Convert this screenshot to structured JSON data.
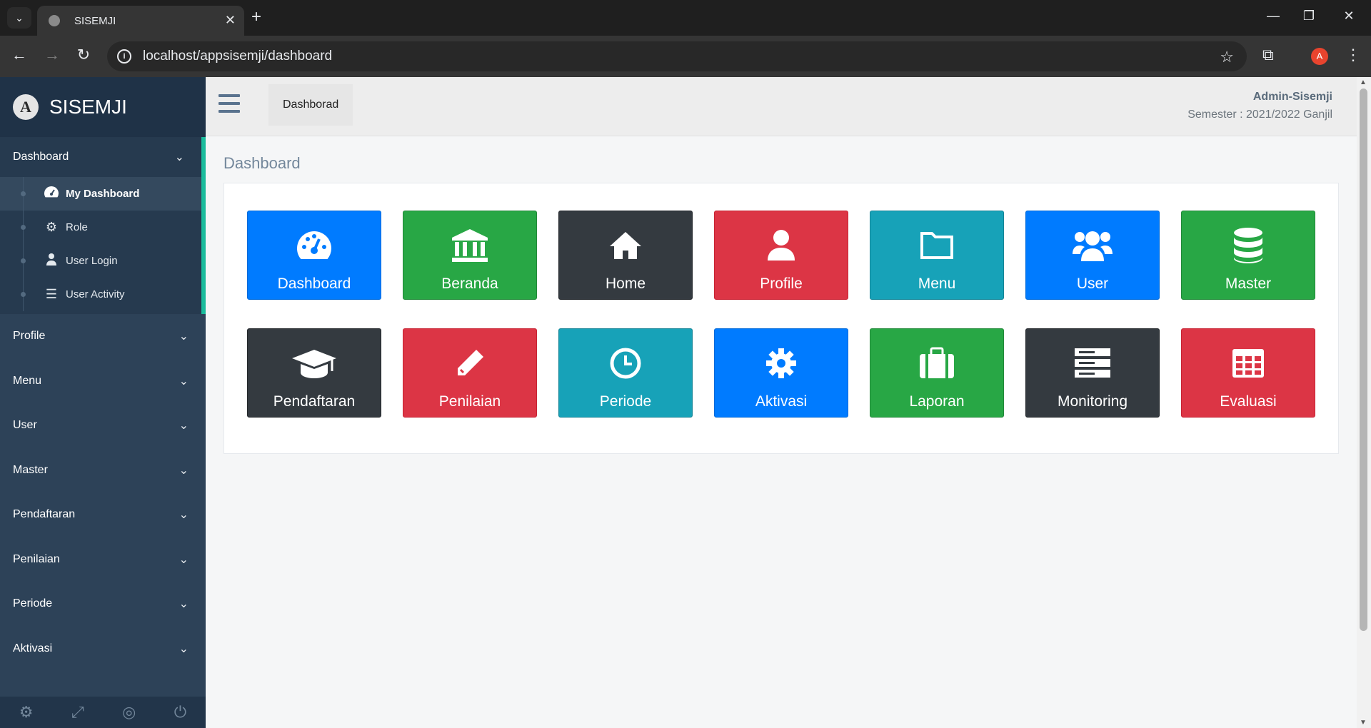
{
  "browser": {
    "tab_title": "SISEMJI",
    "url": "localhost/appsisemji/dashboard",
    "profile_initial": "A"
  },
  "brand": {
    "name": "SISEMJI",
    "logo_letter": "A"
  },
  "sidebar": {
    "open_menu": {
      "label": "Dashboard",
      "items": [
        {
          "label": "My Dashboard",
          "icon": "tachometer-icon"
        },
        {
          "label": "Role",
          "icon": "cogs-icon"
        },
        {
          "label": "User Login",
          "icon": "user-secret-icon"
        },
        {
          "label": "User Activity",
          "icon": "list-icon"
        }
      ]
    },
    "menus": [
      "Profile",
      "Menu",
      "User",
      "Master",
      "Pendaftaran",
      "Penilaian",
      "Periode",
      "Aktivasi"
    ],
    "footer_icons": [
      "settings-icon",
      "fullscreen-icon",
      "lock-icon",
      "logout-icon"
    ]
  },
  "header": {
    "breadcrumb": "Dashborad",
    "user_name": "Admin-Sisemji",
    "semester": "Semester : 2021/2022 Ganjil"
  },
  "content": {
    "title": "Dashboard",
    "tiles": [
      {
        "label": "Dashboard",
        "icon": "tachometer-icon",
        "color": "#007bff"
      },
      {
        "label": "Beranda",
        "icon": "bank-icon",
        "color": "#28a745"
      },
      {
        "label": "Home",
        "icon": "home-icon",
        "color": "#343a40"
      },
      {
        "label": "Profile",
        "icon": "user-icon",
        "color": "#dc3545"
      },
      {
        "label": "Menu",
        "icon": "folder-icon",
        "color": "#17a2b8"
      },
      {
        "label": "User",
        "icon": "users-icon",
        "color": "#007bff"
      },
      {
        "label": "Master",
        "icon": "database-icon",
        "color": "#28a745"
      },
      {
        "label": "Pendaftaran",
        "icon": "graduation-cap-icon",
        "color": "#343a40"
      },
      {
        "label": "Penilaian",
        "icon": "pencil-icon",
        "color": "#dc3545"
      },
      {
        "label": "Periode",
        "icon": "clock-icon",
        "color": "#17a2b8"
      },
      {
        "label": "Aktivasi",
        "icon": "cog-icon",
        "color": "#007bff"
      },
      {
        "label": "Laporan",
        "icon": "briefcase-icon",
        "color": "#28a745"
      },
      {
        "label": "Monitoring",
        "icon": "server-icon",
        "color": "#343a40"
      },
      {
        "label": "Evaluasi",
        "icon": "table-icon",
        "color": "#dc3545"
      }
    ]
  }
}
